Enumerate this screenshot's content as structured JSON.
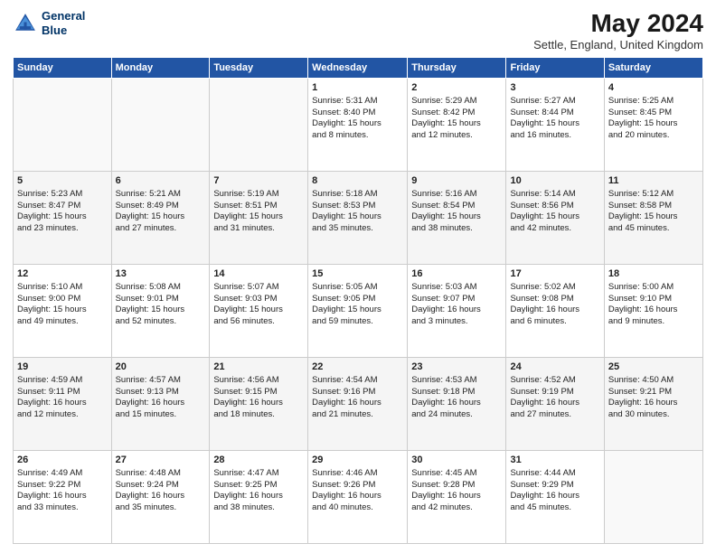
{
  "header": {
    "logo_line1": "General",
    "logo_line2": "Blue",
    "title": "May 2024",
    "subtitle": "Settle, England, United Kingdom"
  },
  "days_of_week": [
    "Sunday",
    "Monday",
    "Tuesday",
    "Wednesday",
    "Thursday",
    "Friday",
    "Saturday"
  ],
  "weeks": [
    [
      {
        "day": "",
        "info": ""
      },
      {
        "day": "",
        "info": ""
      },
      {
        "day": "",
        "info": ""
      },
      {
        "day": "1",
        "info": "Sunrise: 5:31 AM\nSunset: 8:40 PM\nDaylight: 15 hours\nand 8 minutes."
      },
      {
        "day": "2",
        "info": "Sunrise: 5:29 AM\nSunset: 8:42 PM\nDaylight: 15 hours\nand 12 minutes."
      },
      {
        "day": "3",
        "info": "Sunrise: 5:27 AM\nSunset: 8:44 PM\nDaylight: 15 hours\nand 16 minutes."
      },
      {
        "day": "4",
        "info": "Sunrise: 5:25 AM\nSunset: 8:45 PM\nDaylight: 15 hours\nand 20 minutes."
      }
    ],
    [
      {
        "day": "5",
        "info": "Sunrise: 5:23 AM\nSunset: 8:47 PM\nDaylight: 15 hours\nand 23 minutes."
      },
      {
        "day": "6",
        "info": "Sunrise: 5:21 AM\nSunset: 8:49 PM\nDaylight: 15 hours\nand 27 minutes."
      },
      {
        "day": "7",
        "info": "Sunrise: 5:19 AM\nSunset: 8:51 PM\nDaylight: 15 hours\nand 31 minutes."
      },
      {
        "day": "8",
        "info": "Sunrise: 5:18 AM\nSunset: 8:53 PM\nDaylight: 15 hours\nand 35 minutes."
      },
      {
        "day": "9",
        "info": "Sunrise: 5:16 AM\nSunset: 8:54 PM\nDaylight: 15 hours\nand 38 minutes."
      },
      {
        "day": "10",
        "info": "Sunrise: 5:14 AM\nSunset: 8:56 PM\nDaylight: 15 hours\nand 42 minutes."
      },
      {
        "day": "11",
        "info": "Sunrise: 5:12 AM\nSunset: 8:58 PM\nDaylight: 15 hours\nand 45 minutes."
      }
    ],
    [
      {
        "day": "12",
        "info": "Sunrise: 5:10 AM\nSunset: 9:00 PM\nDaylight: 15 hours\nand 49 minutes."
      },
      {
        "day": "13",
        "info": "Sunrise: 5:08 AM\nSunset: 9:01 PM\nDaylight: 15 hours\nand 52 minutes."
      },
      {
        "day": "14",
        "info": "Sunrise: 5:07 AM\nSunset: 9:03 PM\nDaylight: 15 hours\nand 56 minutes."
      },
      {
        "day": "15",
        "info": "Sunrise: 5:05 AM\nSunset: 9:05 PM\nDaylight: 15 hours\nand 59 minutes."
      },
      {
        "day": "16",
        "info": "Sunrise: 5:03 AM\nSunset: 9:07 PM\nDaylight: 16 hours\nand 3 minutes."
      },
      {
        "day": "17",
        "info": "Sunrise: 5:02 AM\nSunset: 9:08 PM\nDaylight: 16 hours\nand 6 minutes."
      },
      {
        "day": "18",
        "info": "Sunrise: 5:00 AM\nSunset: 9:10 PM\nDaylight: 16 hours\nand 9 minutes."
      }
    ],
    [
      {
        "day": "19",
        "info": "Sunrise: 4:59 AM\nSunset: 9:11 PM\nDaylight: 16 hours\nand 12 minutes."
      },
      {
        "day": "20",
        "info": "Sunrise: 4:57 AM\nSunset: 9:13 PM\nDaylight: 16 hours\nand 15 minutes."
      },
      {
        "day": "21",
        "info": "Sunrise: 4:56 AM\nSunset: 9:15 PM\nDaylight: 16 hours\nand 18 minutes."
      },
      {
        "day": "22",
        "info": "Sunrise: 4:54 AM\nSunset: 9:16 PM\nDaylight: 16 hours\nand 21 minutes."
      },
      {
        "day": "23",
        "info": "Sunrise: 4:53 AM\nSunset: 9:18 PM\nDaylight: 16 hours\nand 24 minutes."
      },
      {
        "day": "24",
        "info": "Sunrise: 4:52 AM\nSunset: 9:19 PM\nDaylight: 16 hours\nand 27 minutes."
      },
      {
        "day": "25",
        "info": "Sunrise: 4:50 AM\nSunset: 9:21 PM\nDaylight: 16 hours\nand 30 minutes."
      }
    ],
    [
      {
        "day": "26",
        "info": "Sunrise: 4:49 AM\nSunset: 9:22 PM\nDaylight: 16 hours\nand 33 minutes."
      },
      {
        "day": "27",
        "info": "Sunrise: 4:48 AM\nSunset: 9:24 PM\nDaylight: 16 hours\nand 35 minutes."
      },
      {
        "day": "28",
        "info": "Sunrise: 4:47 AM\nSunset: 9:25 PM\nDaylight: 16 hours\nand 38 minutes."
      },
      {
        "day": "29",
        "info": "Sunrise: 4:46 AM\nSunset: 9:26 PM\nDaylight: 16 hours\nand 40 minutes."
      },
      {
        "day": "30",
        "info": "Sunrise: 4:45 AM\nSunset: 9:28 PM\nDaylight: 16 hours\nand 42 minutes."
      },
      {
        "day": "31",
        "info": "Sunrise: 4:44 AM\nSunset: 9:29 PM\nDaylight: 16 hours\nand 45 minutes."
      },
      {
        "day": "",
        "info": ""
      }
    ]
  ]
}
